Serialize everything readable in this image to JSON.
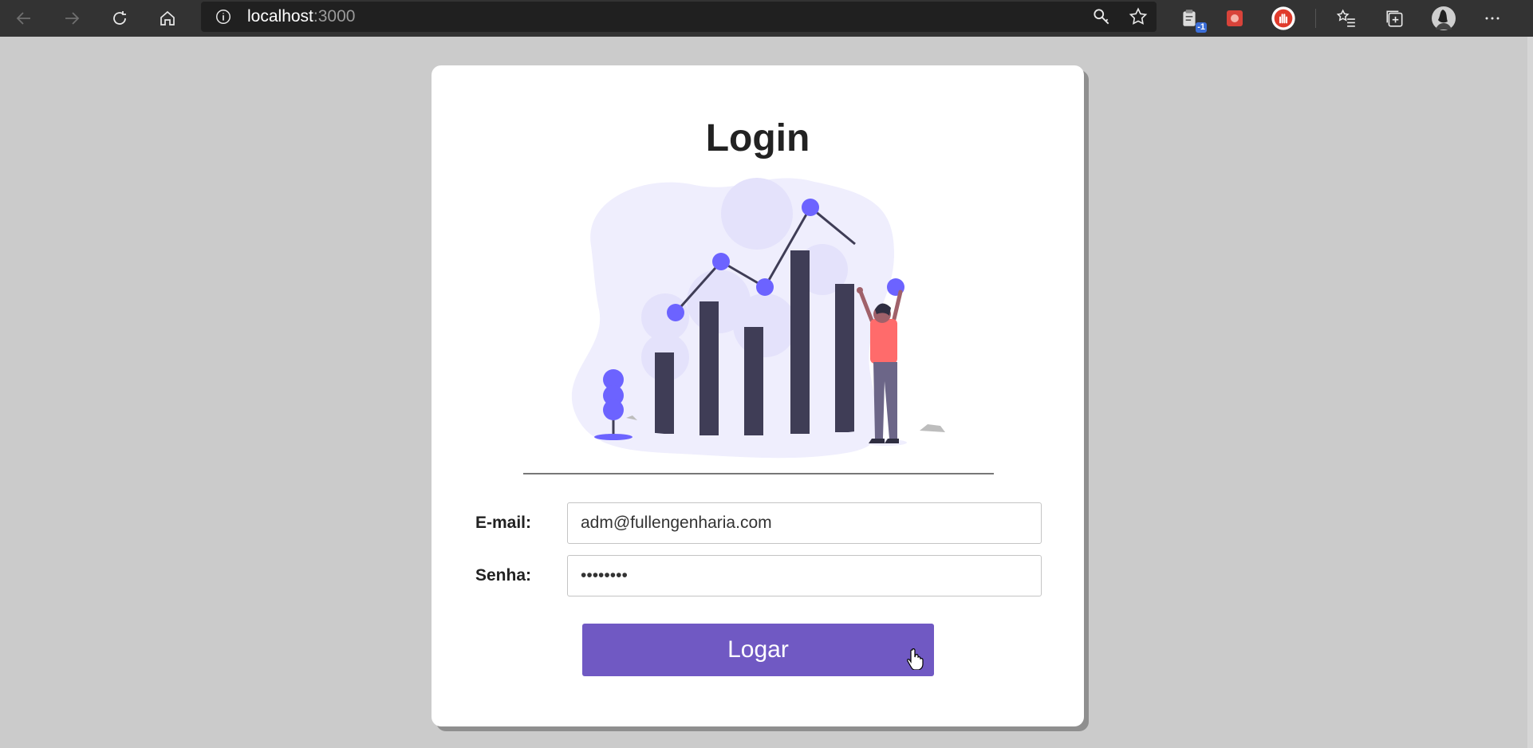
{
  "browser": {
    "url_host": "localhost",
    "url_port": ":3000",
    "extension_badge": "-1"
  },
  "login": {
    "title": "Login",
    "email_label": "E-mail:",
    "email_value": "adm@fullengenharia.com",
    "password_label": "Senha:",
    "password_value": "••••••••",
    "submit_label": "Logar"
  },
  "colors": {
    "browser_bar": "#333333",
    "page_background": "#cbcbcb",
    "button": "#7059c3",
    "illustration_accent": "#6c63ff",
    "illustration_dark": "#3f3d56",
    "illustration_person_shirt": "#ff6b6b"
  }
}
